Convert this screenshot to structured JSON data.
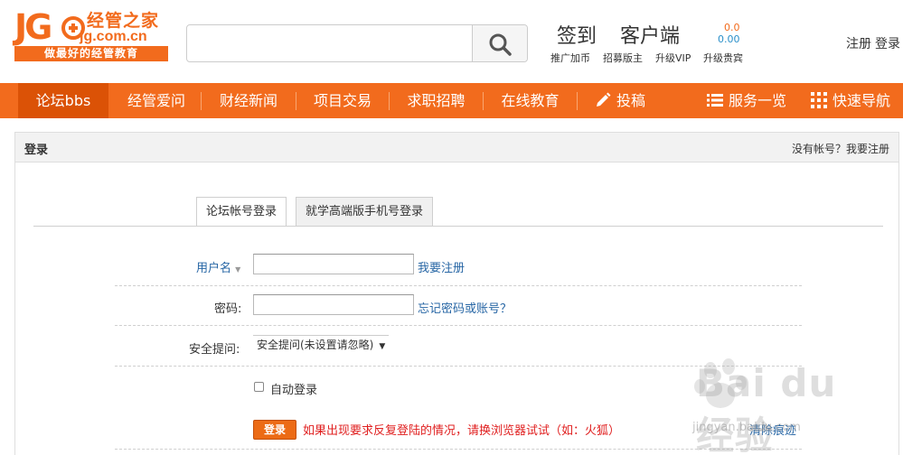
{
  "logo": {
    "letters": "JG",
    "name_cn": "经管之家",
    "domain": "jg.com.cn",
    "slogan": "做最好的经管教育"
  },
  "search": {
    "placeholder": "",
    "button_icon": "search-icon"
  },
  "header_links": {
    "signin": "签到",
    "client": "客户端",
    "promote": "推广加币",
    "recruit_mod": "招募版主",
    "upgrade_vip": "升级VIP",
    "upgrade_noble": "升级贵宾",
    "coin_a": "0.0",
    "coin_b": "0.00",
    "register": "注册",
    "login": "登录"
  },
  "nav": {
    "items": [
      {
        "label": "论坛bbs",
        "active": true
      },
      {
        "label": "经管爱问"
      },
      {
        "label": "财经新闻"
      },
      {
        "label": "项目交易"
      },
      {
        "label": "求职招聘"
      },
      {
        "label": "在线教育"
      },
      {
        "label": "投稿",
        "icon": "pencil-icon"
      },
      {
        "label": "服务一览",
        "icon": "list-icon"
      },
      {
        "label": "快速导航",
        "icon": "grid-icon"
      }
    ]
  },
  "login_panel": {
    "title": "登录",
    "no_account": "没有帐号？",
    "register_link": "我要注册",
    "tabs": [
      {
        "label": "论坛帐号登录",
        "active": true
      },
      {
        "label": "就学高端版手机号登录"
      }
    ],
    "username_label": "用户名",
    "register_here": "我要注册",
    "password_label": "密码:",
    "forgot": "忘记密码或账号？",
    "question_label": "安全提问:",
    "question_selected": "安全提问(未设置请忽略)",
    "auto_login": "自动登录",
    "login_button": "登录",
    "warning": "如果出现要求反复登陆的情况，请换浏览器试试（如：火狐）",
    "clear_traces": "清除痕迹"
  },
  "watermark": {
    "text": "Bai du 经验",
    "url": "jingyan.baidu.com"
  },
  "colors": {
    "brand_orange": "#f26b1d",
    "nav_active": "#db5206",
    "link_blue": "#2766a5",
    "warning_red": "#e02020"
  }
}
